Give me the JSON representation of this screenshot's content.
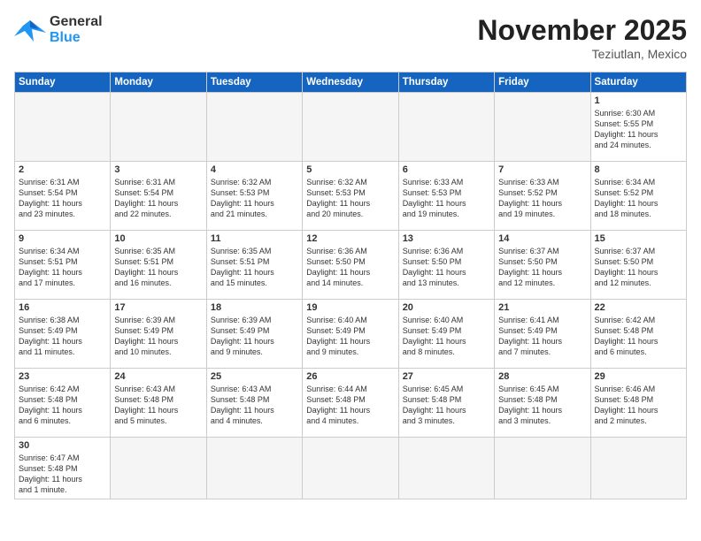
{
  "header": {
    "logo_line1": "General",
    "logo_line2": "Blue",
    "month": "November 2025",
    "location": "Teziutlan, Mexico"
  },
  "weekdays": [
    "Sunday",
    "Monday",
    "Tuesday",
    "Wednesday",
    "Thursday",
    "Friday",
    "Saturday"
  ],
  "weeks": [
    [
      {
        "day": "",
        "text": ""
      },
      {
        "day": "",
        "text": ""
      },
      {
        "day": "",
        "text": ""
      },
      {
        "day": "",
        "text": ""
      },
      {
        "day": "",
        "text": ""
      },
      {
        "day": "",
        "text": ""
      },
      {
        "day": "1",
        "text": "Sunrise: 6:30 AM\nSunset: 5:55 PM\nDaylight: 11 hours\nand 24 minutes."
      }
    ],
    [
      {
        "day": "2",
        "text": "Sunrise: 6:31 AM\nSunset: 5:54 PM\nDaylight: 11 hours\nand 23 minutes."
      },
      {
        "day": "3",
        "text": "Sunrise: 6:31 AM\nSunset: 5:54 PM\nDaylight: 11 hours\nand 22 minutes."
      },
      {
        "day": "4",
        "text": "Sunrise: 6:32 AM\nSunset: 5:53 PM\nDaylight: 11 hours\nand 21 minutes."
      },
      {
        "day": "5",
        "text": "Sunrise: 6:32 AM\nSunset: 5:53 PM\nDaylight: 11 hours\nand 20 minutes."
      },
      {
        "day": "6",
        "text": "Sunrise: 6:33 AM\nSunset: 5:53 PM\nDaylight: 11 hours\nand 19 minutes."
      },
      {
        "day": "7",
        "text": "Sunrise: 6:33 AM\nSunset: 5:52 PM\nDaylight: 11 hours\nand 19 minutes."
      },
      {
        "day": "8",
        "text": "Sunrise: 6:34 AM\nSunset: 5:52 PM\nDaylight: 11 hours\nand 18 minutes."
      }
    ],
    [
      {
        "day": "9",
        "text": "Sunrise: 6:34 AM\nSunset: 5:51 PM\nDaylight: 11 hours\nand 17 minutes."
      },
      {
        "day": "10",
        "text": "Sunrise: 6:35 AM\nSunset: 5:51 PM\nDaylight: 11 hours\nand 16 minutes."
      },
      {
        "day": "11",
        "text": "Sunrise: 6:35 AM\nSunset: 5:51 PM\nDaylight: 11 hours\nand 15 minutes."
      },
      {
        "day": "12",
        "text": "Sunrise: 6:36 AM\nSunset: 5:50 PM\nDaylight: 11 hours\nand 14 minutes."
      },
      {
        "day": "13",
        "text": "Sunrise: 6:36 AM\nSunset: 5:50 PM\nDaylight: 11 hours\nand 13 minutes."
      },
      {
        "day": "14",
        "text": "Sunrise: 6:37 AM\nSunset: 5:50 PM\nDaylight: 11 hours\nand 12 minutes."
      },
      {
        "day": "15",
        "text": "Sunrise: 6:37 AM\nSunset: 5:50 PM\nDaylight: 11 hours\nand 12 minutes."
      }
    ],
    [
      {
        "day": "16",
        "text": "Sunrise: 6:38 AM\nSunset: 5:49 PM\nDaylight: 11 hours\nand 11 minutes."
      },
      {
        "day": "17",
        "text": "Sunrise: 6:39 AM\nSunset: 5:49 PM\nDaylight: 11 hours\nand 10 minutes."
      },
      {
        "day": "18",
        "text": "Sunrise: 6:39 AM\nSunset: 5:49 PM\nDaylight: 11 hours\nand 9 minutes."
      },
      {
        "day": "19",
        "text": "Sunrise: 6:40 AM\nSunset: 5:49 PM\nDaylight: 11 hours\nand 9 minutes."
      },
      {
        "day": "20",
        "text": "Sunrise: 6:40 AM\nSunset: 5:49 PM\nDaylight: 11 hours\nand 8 minutes."
      },
      {
        "day": "21",
        "text": "Sunrise: 6:41 AM\nSunset: 5:49 PM\nDaylight: 11 hours\nand 7 minutes."
      },
      {
        "day": "22",
        "text": "Sunrise: 6:42 AM\nSunset: 5:48 PM\nDaylight: 11 hours\nand 6 minutes."
      }
    ],
    [
      {
        "day": "23",
        "text": "Sunrise: 6:42 AM\nSunset: 5:48 PM\nDaylight: 11 hours\nand 6 minutes."
      },
      {
        "day": "24",
        "text": "Sunrise: 6:43 AM\nSunset: 5:48 PM\nDaylight: 11 hours\nand 5 minutes."
      },
      {
        "day": "25",
        "text": "Sunrise: 6:43 AM\nSunset: 5:48 PM\nDaylight: 11 hours\nand 4 minutes."
      },
      {
        "day": "26",
        "text": "Sunrise: 6:44 AM\nSunset: 5:48 PM\nDaylight: 11 hours\nand 4 minutes."
      },
      {
        "day": "27",
        "text": "Sunrise: 6:45 AM\nSunset: 5:48 PM\nDaylight: 11 hours\nand 3 minutes."
      },
      {
        "day": "28",
        "text": "Sunrise: 6:45 AM\nSunset: 5:48 PM\nDaylight: 11 hours\nand 3 minutes."
      },
      {
        "day": "29",
        "text": "Sunrise: 6:46 AM\nSunset: 5:48 PM\nDaylight: 11 hours\nand 2 minutes."
      }
    ],
    [
      {
        "day": "30",
        "text": "Sunrise: 6:47 AM\nSunset: 5:48 PM\nDaylight: 11 hours\nand 1 minute."
      },
      {
        "day": "",
        "text": ""
      },
      {
        "day": "",
        "text": ""
      },
      {
        "day": "",
        "text": ""
      },
      {
        "day": "",
        "text": ""
      },
      {
        "day": "",
        "text": ""
      },
      {
        "day": "",
        "text": ""
      }
    ]
  ]
}
